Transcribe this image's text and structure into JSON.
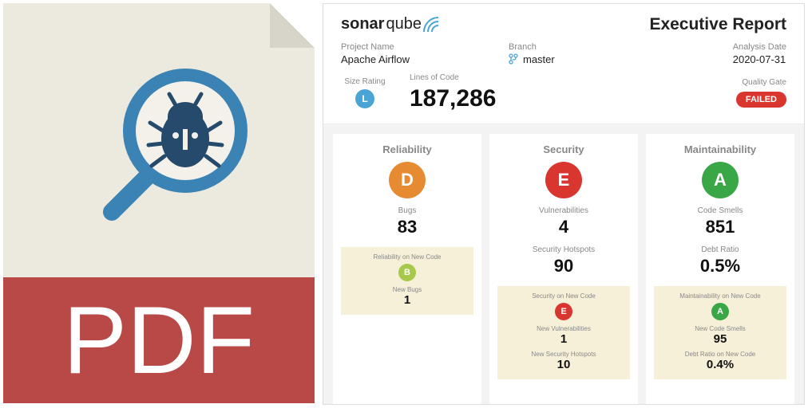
{
  "pdf": {
    "label": "PDF"
  },
  "brand": {
    "sonar": "sonar",
    "qube": "qube"
  },
  "report": {
    "title": "Executive Report",
    "projectNameLabel": "Project Name",
    "projectName": "Apache Airflow",
    "branchLabel": "Branch",
    "branch": "master",
    "analysisDateLabel": "Analysis Date",
    "analysisDate": "2020-07-31",
    "sizeRatingLabel": "Size Rating",
    "sizeRating": "L",
    "locLabel": "Lines of Code",
    "loc": "187,286",
    "qualityGateLabel": "Quality Gate",
    "qualityGate": "FAILED"
  },
  "cards": {
    "reliability": {
      "title": "Reliability",
      "rating": "D",
      "metricLabel": "Bugs",
      "metricVal": "83",
      "new": {
        "title": "Reliability on New Code",
        "rating": "B",
        "label1": "New Bugs",
        "val1": "1"
      }
    },
    "security": {
      "title": "Security",
      "rating": "E",
      "metric1Label": "Vulnerabilities",
      "metric1Val": "4",
      "metric2Label": "Security Hotspots",
      "metric2Val": "90",
      "new": {
        "title": "Security on New Code",
        "rating": "E",
        "label1": "New Vulnerabilities",
        "val1": "1",
        "label2": "New Security Hotspots",
        "val2": "10"
      }
    },
    "maintainability": {
      "title": "Maintainability",
      "rating": "A",
      "metric1Label": "Code Smells",
      "metric1Val": "851",
      "metric2Label": "Debt Ratio",
      "metric2Val": "0.5%",
      "new": {
        "title": "Maintainability on New Code",
        "rating": "A",
        "label1": "New Code Smells",
        "val1": "95",
        "label2": "Debt Ratio on New Code",
        "val2": "0.4%"
      }
    }
  }
}
